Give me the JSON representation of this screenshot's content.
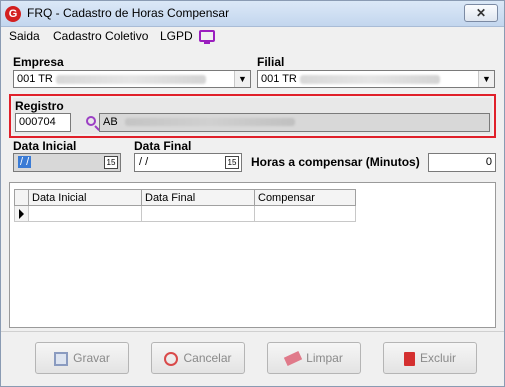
{
  "window": {
    "title": "FRQ - Cadastro de Horas Compensar",
    "close": "✕",
    "app_icon": "G"
  },
  "menu": [
    {
      "label": "Saida",
      "u": "S"
    },
    {
      "label": "Cadastro Coletivo",
      "u": "C"
    },
    {
      "label": "LGPD",
      "u": "L"
    }
  ],
  "empresa": {
    "label": "Empresa",
    "value": "001 TR"
  },
  "filial": {
    "label": "Filial",
    "value": "001 TR"
  },
  "registro": {
    "label": "Registro",
    "code": "000704",
    "name_prefix": "AB"
  },
  "data_inicial": {
    "label": "Data Inicial",
    "value": " / /"
  },
  "data_final": {
    "label": "Data Final",
    "value": " / /"
  },
  "horas": {
    "label": "Horas a compensar (Minutos)",
    "value": "0"
  },
  "grid": {
    "columns": [
      "Data Inicial",
      "Data Final",
      "Compensar"
    ]
  },
  "buttons": {
    "gravar": "Gravar",
    "cancelar": "Cancelar",
    "limpar": "Limpar",
    "excluir": "Excluir"
  },
  "calendar_icon_text": "15"
}
